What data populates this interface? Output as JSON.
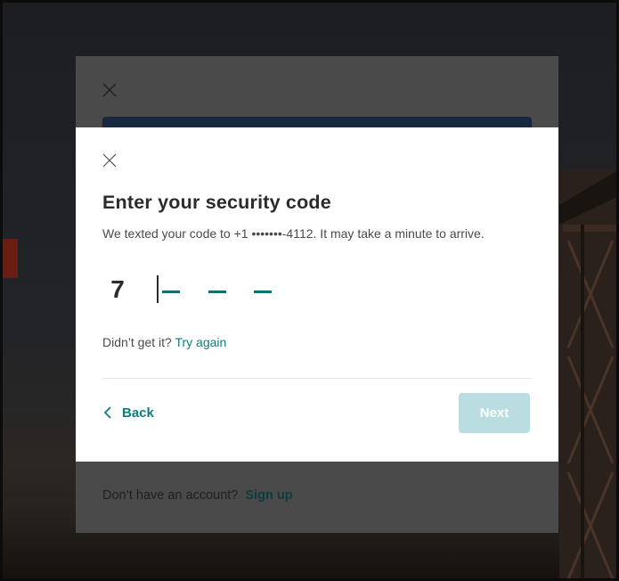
{
  "modal": {
    "title": "Enter your security code",
    "subtitle": "We texted your code to +1 •••••••-4112. It may take a minute to arrive.",
    "code_digits": [
      "7",
      "",
      "",
      ""
    ],
    "resend_prefix": "Didn’t get it?",
    "resend_link": "Try again",
    "back_label": "Back",
    "next_label": "Next",
    "accent_color": "#0e7c80",
    "next_disabled_color": "#b9dde0"
  },
  "background_card": {
    "footer_prefix": "Don’t have an account?",
    "footer_link": "Sign up"
  },
  "icons": {
    "close": "close-icon",
    "back": "chevron-left-icon"
  }
}
